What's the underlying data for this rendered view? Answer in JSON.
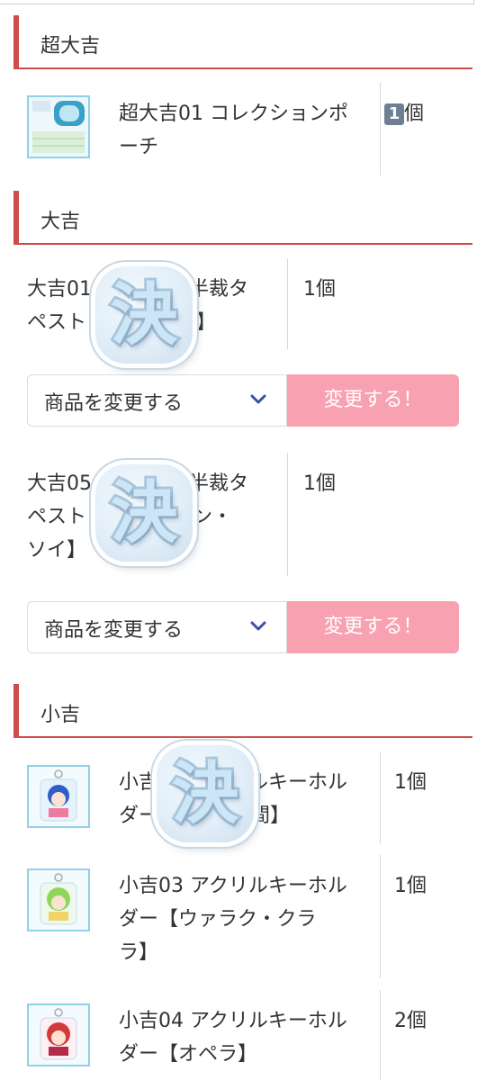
{
  "colors": {
    "accent": "#cc4d4d",
    "button": "#f7a1b1",
    "thumb_border": "#8fd0ea"
  },
  "sections": [
    {
      "title": "超大吉"
    },
    {
      "title": "大吉"
    },
    {
      "title": "小吉"
    }
  ],
  "items": {
    "chodaikichi_01": {
      "name_line1": "超大吉01 コレクションポ",
      "name_line2": "ーチ",
      "qty": "個",
      "qty_prefix_icon": "keycap-1-icon"
    },
    "daikichi_a": {
      "name_line1": "大吉01",
      "name_line1_tail": "半裁タ",
      "name_line2": "ペスト",
      "name_line2_tail": "入間】",
      "qty": "1個"
    },
    "daikichi_b": {
      "name_line1": "大吉05",
      "name_line1_tail": "半裁タ",
      "name_line2": "ペスト",
      "name_line2_tail": "ソン・",
      "name_line3": "ソイ】",
      "qty": "1個"
    },
    "shokichi_a": {
      "name_line1": "小吉",
      "name_line1_tail": "ルキーホル",
      "name_line2": "ダー",
      "name_line2_tail": "間】",
      "qty": "1個"
    },
    "shokichi_03": {
      "name_line1": "小吉03 アクリルキーホル",
      "name_line2": "ダー【ウァラク・クラ",
      "name_line3": "ラ】",
      "qty": "1個"
    },
    "shokichi_04": {
      "name_line1": "小吉04 アクリルキーホル",
      "name_line2": "ダー【オペラ】",
      "qty": "2個"
    }
  },
  "controls": {
    "select_label": "商品を変更する",
    "change_button": "変更する！"
  },
  "stamp": {
    "text": "決"
  },
  "icons": {
    "chevron": "chevron-down-icon"
  }
}
